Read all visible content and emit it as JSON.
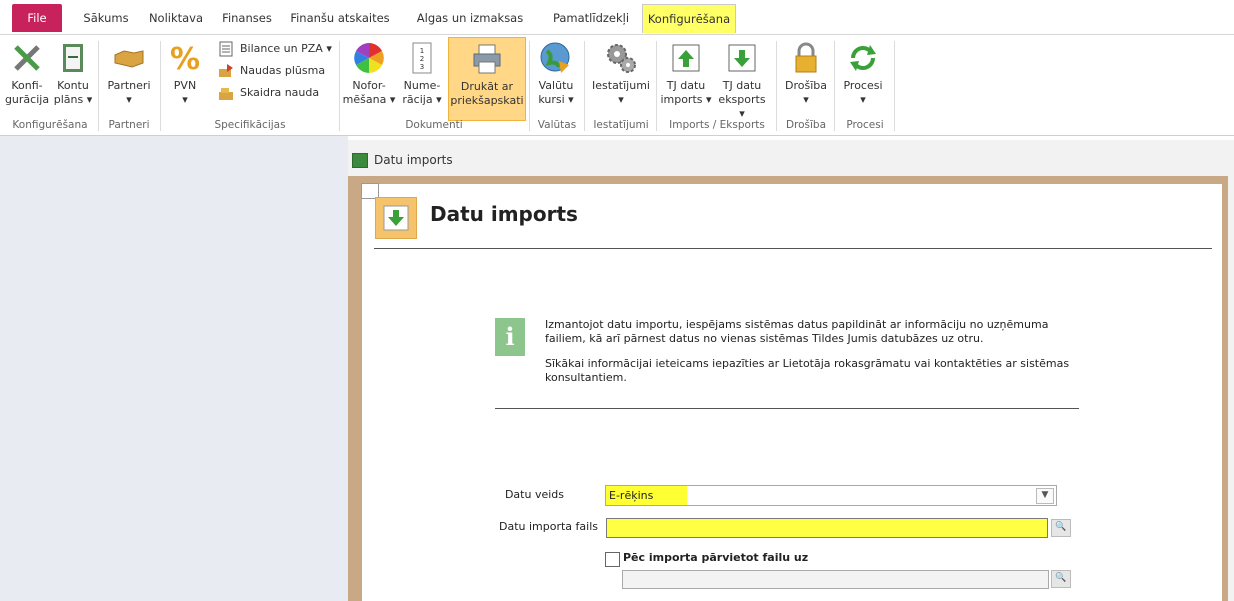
{
  "tabs": [
    "File",
    "Sākums",
    "Noliktava",
    "Finanses",
    "Finanšu atskaites",
    "Algas un izmaksas",
    "Pamatlīdzekļi",
    "Konfigurēšana"
  ],
  "ribbon": {
    "konfiguracija": [
      "Konfi-",
      "gurācija"
    ],
    "kontu_plans": [
      "Kontu",
      "plāns ▾"
    ],
    "partneri": [
      "Partneri",
      "▾"
    ],
    "pvn": [
      "PVN",
      "▾"
    ],
    "bilance": "Bilance un PZA ▾",
    "naudas_plusma": "Naudas plūsma",
    "skaidra_nauda": "Skaidra nauda",
    "noformesana": [
      "Nofor-",
      "mēšana ▾"
    ],
    "numeracija": [
      "Nume-",
      "rācija ▾"
    ],
    "drukat": [
      "Drukāt ar",
      "priekšapskati"
    ],
    "valutu_kursi": [
      "Valūtu",
      "kursi ▾"
    ],
    "iestatijumi": [
      "Iestatījumi",
      "▾"
    ],
    "tj_imports": [
      "TJ datu",
      "imports ▾"
    ],
    "tj_eksports": [
      "TJ datu",
      "eksports ▾"
    ],
    "drosiba": [
      "Drošība",
      "▾"
    ],
    "procesi": [
      "Procesi",
      "▾"
    ],
    "groups": [
      "Konfigurēšana",
      "Partneri",
      "Specifikācijas",
      "Dokumenti",
      "Valūtas",
      "Iestatījumi",
      "Imports / Eksports",
      "Drošība",
      "Procesi"
    ]
  },
  "window": {
    "title": "Datu imports",
    "header": "Datu imports",
    "info_p1": "Izmantojot datu importu, iespējams sistēmas datus papildināt ar informāciju no uzņēmuma failiem, kā arī pārnest datus no vienas sistēmas Tildes Jumis datubāzes uz otru.",
    "info_p2": "Sīkākai informācijai ieteicams iepazīties ar Lietotāja rokasgrāmatu vai kontaktēties ar sistēmas konsultantiem.",
    "datu_veids_label": "Datu veids",
    "datu_veids_value": "E-rēķins",
    "datu_importa_fails_label": "Datu importa fails",
    "datu_importa_fails_value": "",
    "checkbox_label": "Pēc importa pārvietot failu uz",
    "move_path_value": ""
  },
  "colors": {
    "file_tab": "#c8225c",
    "active_tab": "#ffff66",
    "highlight_button": "#ffd787",
    "field_highlight": "#ffff33",
    "frame": "#c9a985",
    "left_pane": "#e8ecf2"
  }
}
